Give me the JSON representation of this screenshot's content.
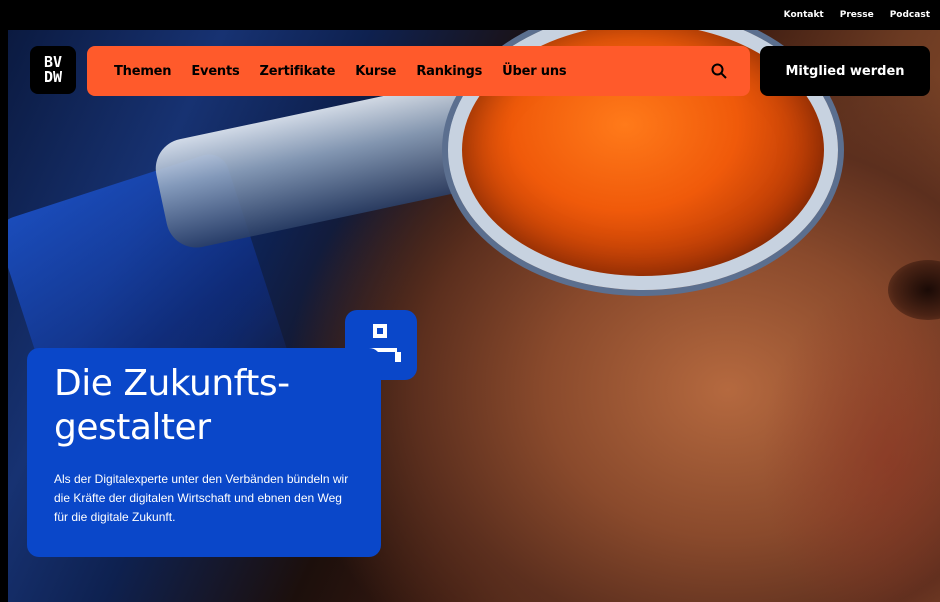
{
  "topbar": {
    "links": [
      "Kontakt",
      "Presse",
      "Podcast"
    ]
  },
  "logo": {
    "text_top": "BV",
    "text_bottom": "DW"
  },
  "nav": {
    "items": [
      "Themen",
      "Events",
      "Zertifikate",
      "Kurse",
      "Rankings",
      "Über uns"
    ],
    "search_icon": "search-icon"
  },
  "cta": {
    "label": "Mitglied werden"
  },
  "hero": {
    "title": "Die Zukunfts- gestalter",
    "text": "Als der Digitalexperte unter den Verbänden bündeln wir die Kräfte der digitalen Wirtschaft und ebnen den Weg für die digitale Zukunft.",
    "icon": "user-icon"
  },
  "colors": {
    "nav_bg": "#ff5a2b",
    "card_bg": "#0a47c9",
    "cta_bg": "#000000"
  }
}
